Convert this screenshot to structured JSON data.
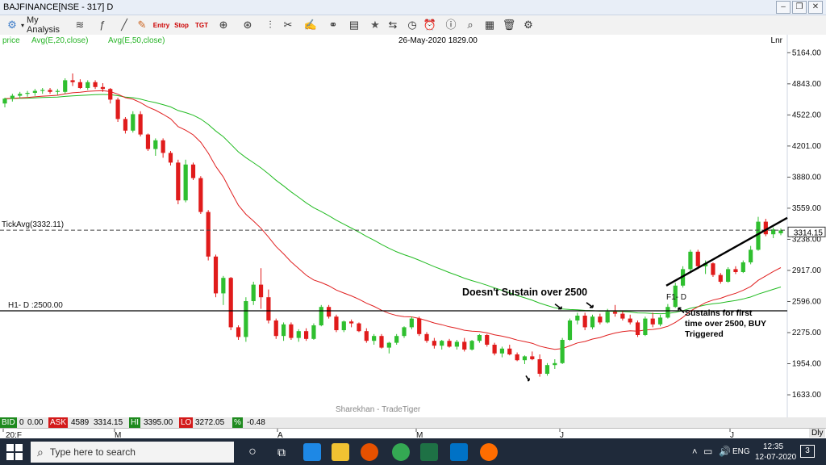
{
  "window": {
    "title": "BAJFINANCE[NSE - 317] D"
  },
  "toolbar": {
    "my_analysis": "My Analysis",
    "tools": [
      "chart-type-icon",
      "indicator-icon",
      "annotate-icon",
      "entry-icon",
      "stop-icon",
      "target-icon",
      "crosshair-icon",
      "zoom-icon",
      "draw-icon",
      "multi-icon",
      "link-icon",
      "book-icon",
      "star-icon",
      "compare-icon",
      "timer-icon",
      "search-icon",
      "notes-icon",
      "delete-icon",
      "settings-icon"
    ],
    "entry_label": "Entry",
    "stop_label": "Stop",
    "tgt_label": "TGT"
  },
  "chart": {
    "legend": {
      "price": "price",
      "ema20": "Avg(E,20,close)",
      "ema50": "Avg(E,50,close)"
    },
    "date_stamp": "26-May-2020 1829.00",
    "scale_mode": "Lnr",
    "tick_avg_label": "TickAvg(3332.11)",
    "h1_label": "H1- D :2500.00",
    "f1_label": "F1- D",
    "last_price_tag": "3314.15",
    "watermark": "Sharekhan - TradeTiger",
    "annotation_1": "Doesn't Sustain over 2500",
    "annotation_2": "Sustains for first time over 2500, BUY Triggered",
    "colors": {
      "up": "#2fbf2f",
      "down": "#e01b1b",
      "ema20": "#e02020",
      "ema50": "#22bb22",
      "legend": "#27b427"
    }
  },
  "chart_data": {
    "type": "candlestick",
    "y_ticks": [
      "5164.00",
      "4843.00",
      "4522.00",
      "4201.00",
      "3880.00",
      "3559.00",
      "3238.00",
      "2917.00",
      "2596.00",
      "2275.00",
      "1954.00",
      "1633.00"
    ],
    "ylim": [
      1400,
      5350
    ],
    "x_ticks": [
      "20:F",
      "M",
      "A",
      "M",
      "J",
      "J"
    ],
    "horizontal_level": 2500,
    "tick_avg": 3332.11,
    "candles": [
      [
        4640,
        4700,
        4600,
        4690
      ],
      [
        4690,
        4740,
        4660,
        4720
      ],
      [
        4720,
        4760,
        4690,
        4740
      ],
      [
        4740,
        4770,
        4710,
        4750
      ],
      [
        4750,
        4790,
        4720,
        4770
      ],
      [
        4770,
        4800,
        4740,
        4780
      ],
      [
        4780,
        4800,
        4740,
        4760
      ],
      [
        4760,
        4790,
        4730,
        4770
      ],
      [
        4760,
        4900,
        4740,
        4880
      ],
      [
        4880,
        4950,
        4820,
        4860
      ],
      [
        4860,
        4890,
        4790,
        4800
      ],
      [
        4800,
        4880,
        4780,
        4860
      ],
      [
        4860,
        4880,
        4790,
        4810
      ],
      [
        4810,
        4850,
        4760,
        4790
      ],
      [
        4790,
        4800,
        4640,
        4680
      ],
      [
        4680,
        4700,
        4450,
        4480
      ],
      [
        4480,
        4500,
        4330,
        4360
      ],
      [
        4360,
        4560,
        4340,
        4530
      ],
      [
        4530,
        4560,
        4300,
        4320
      ],
      [
        4320,
        4330,
        4150,
        4170
      ],
      [
        4170,
        4280,
        4100,
        4260
      ],
      [
        4260,
        4280,
        4080,
        4130
      ],
      [
        4130,
        4150,
        4000,
        4030
      ],
      [
        4030,
        4060,
        3600,
        3640
      ],
      [
        3640,
        4060,
        3620,
        4010
      ],
      [
        4010,
        4030,
        3850,
        3870
      ],
      [
        3870,
        3890,
        3500,
        3520
      ],
      [
        3520,
        3540,
        3020,
        3060
      ],
      [
        3060,
        3080,
        2640,
        2680
      ],
      [
        2680,
        2860,
        2560,
        2840
      ],
      [
        2840,
        2850,
        2300,
        2330
      ],
      [
        2330,
        2350,
        2200,
        2230
      ],
      [
        2230,
        2640,
        2180,
        2600
      ],
      [
        2600,
        2800,
        2560,
        2770
      ],
      [
        2770,
        2940,
        2520,
        2640
      ],
      [
        2640,
        2720,
        2370,
        2400
      ],
      [
        2400,
        2420,
        2210,
        2240
      ],
      [
        2240,
        2380,
        2190,
        2360
      ],
      [
        2360,
        2380,
        2200,
        2220
      ],
      [
        2220,
        2310,
        2180,
        2290
      ],
      [
        2290,
        2320,
        2190,
        2210
      ],
      [
        2210,
        2370,
        2200,
        2350
      ],
      [
        2350,
        2560,
        2340,
        2540
      ],
      [
        2540,
        2560,
        2420,
        2440
      ],
      [
        2440,
        2460,
        2280,
        2300
      ],
      [
        2300,
        2400,
        2280,
        2390
      ],
      [
        2390,
        2410,
        2330,
        2370
      ],
      [
        2370,
        2380,
        2280,
        2290
      ],
      [
        2290,
        2320,
        2170,
        2190
      ],
      [
        2190,
        2260,
        2150,
        2240
      ],
      [
        2240,
        2260,
        2110,
        2120
      ],
      [
        2120,
        2180,
        2060,
        2170
      ],
      [
        2170,
        2260,
        2150,
        2240
      ],
      [
        2240,
        2340,
        2220,
        2330
      ],
      [
        2330,
        2440,
        2310,
        2420
      ],
      [
        2420,
        2440,
        2240,
        2260
      ],
      [
        2260,
        2280,
        2170,
        2190
      ],
      [
        2190,
        2220,
        2110,
        2140
      ],
      [
        2140,
        2200,
        2100,
        2190
      ],
      [
        2190,
        2210,
        2120,
        2130
      ],
      [
        2130,
        2200,
        2100,
        2180
      ],
      [
        2180,
        2220,
        2080,
        2100
      ],
      [
        2100,
        2200,
        2090,
        2190
      ],
      [
        2190,
        2260,
        2170,
        2250
      ],
      [
        2250,
        2260,
        2130,
        2150
      ],
      [
        2150,
        2170,
        2040,
        2060
      ],
      [
        2060,
        2130,
        2020,
        2110
      ],
      [
        2110,
        2150,
        2040,
        2050
      ],
      [
        2050,
        2070,
        1980,
        1990
      ],
      [
        1990,
        2040,
        1950,
        2030
      ],
      [
        2030,
        2080,
        1990,
        2000
      ],
      [
        2000,
        2050,
        1820,
        1850
      ],
      [
        1850,
        1960,
        1830,
        1940
      ],
      [
        1940,
        2000,
        1900,
        1960
      ],
      [
        1960,
        2220,
        1950,
        2200
      ],
      [
        2200,
        2420,
        2190,
        2400
      ],
      [
        2400,
        2480,
        2360,
        2450
      ],
      [
        2450,
        2480,
        2300,
        2330
      ],
      [
        2330,
        2460,
        2310,
        2440
      ],
      [
        2440,
        2470,
        2360,
        2380
      ],
      [
        2380,
        2520,
        2370,
        2490
      ],
      [
        2490,
        2560,
        2440,
        2470
      ],
      [
        2470,
        2500,
        2400,
        2420
      ],
      [
        2420,
        2460,
        2360,
        2380
      ],
      [
        2380,
        2400,
        2230,
        2250
      ],
      [
        2250,
        2440,
        2240,
        2420
      ],
      [
        2420,
        2480,
        2330,
        2360
      ],
      [
        2360,
        2460,
        2340,
        2430
      ],
      [
        2430,
        2570,
        2420,
        2540
      ],
      [
        2540,
        2790,
        2530,
        2760
      ],
      [
        2760,
        2960,
        2740,
        2930
      ],
      [
        2930,
        3130,
        2900,
        3110
      ],
      [
        3110,
        3130,
        2930,
        2960
      ],
      [
        2960,
        3020,
        2880,
        2990
      ],
      [
        2990,
        3000,
        2850,
        2870
      ],
      [
        2870,
        2890,
        2780,
        2800
      ],
      [
        2800,
        2950,
        2790,
        2930
      ],
      [
        2930,
        2960,
        2880,
        2900
      ],
      [
        2900,
        3020,
        2890,
        3000
      ],
      [
        3000,
        3170,
        2980,
        3130
      ],
      [
        3130,
        3470,
        3120,
        3420
      ],
      [
        3420,
        3450,
        3270,
        3290
      ],
      [
        3290,
        3360,
        3250,
        3340
      ],
      [
        3300,
        3350,
        3280,
        3330
      ]
    ]
  },
  "status": {
    "bid_label": "BID",
    "bid_qty": "0",
    "bid_price": "0.00",
    "ask_label": "ASK",
    "ask_qty": "4589",
    "ask_price": "3314.15",
    "hi_label": "HI",
    "hi_value": "3395.00",
    "lo_label": "LO",
    "lo_value": "3272.05",
    "pct_label": "%",
    "pct_value": "-0.48",
    "dly_label": "Dly"
  },
  "taskbar": {
    "search_placeholder": "Type here to search",
    "language": "ENG",
    "time": "12:35",
    "date": "12-07-2020",
    "notif_count": "3"
  }
}
